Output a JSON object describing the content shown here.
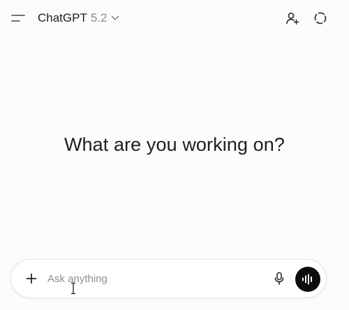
{
  "header": {
    "model_name": "ChatGPT",
    "model_version": "5.2",
    "icons": {
      "menu": "sidebar-toggle-icon",
      "model_dropdown": "chevron-down-icon",
      "add_people": "add-user-icon",
      "temporary_chat": "dashed-circle-icon"
    }
  },
  "main": {
    "headline": "What are you working on?"
  },
  "composer": {
    "placeholder": "Ask anything",
    "value": "",
    "icons": {
      "attach": "plus-icon",
      "dictate": "microphone-icon",
      "voice_mode": "voice-waveform-icon"
    }
  },
  "colors": {
    "background": "#fcfcfb",
    "text": "#1f1f1f",
    "muted": "#8a8a8a",
    "voice_button": "#0d0d0d"
  }
}
